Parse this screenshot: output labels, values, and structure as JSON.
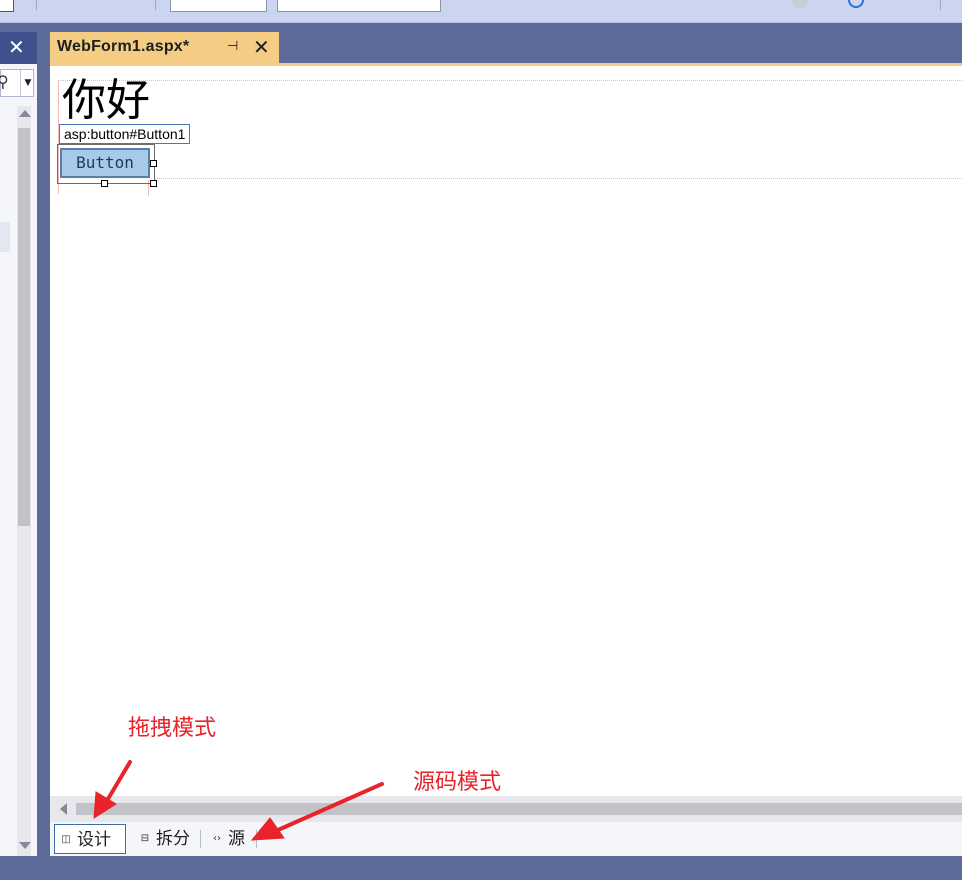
{
  "editor_tab": {
    "title": "WebForm1.aspx*",
    "pin_icon": "pin-icon",
    "close_icon": "close-icon"
  },
  "design_surface": {
    "heading_text": "你好",
    "selected_tag": "asp:button#Button1",
    "button_text": "Button"
  },
  "view_tabs": [
    {
      "label": "设计",
      "icon": "design-view-icon",
      "active": true
    },
    {
      "label": "拆分",
      "icon": "split-view-icon",
      "active": false
    },
    {
      "label": "源",
      "icon": "source-view-icon",
      "active": false
    }
  ],
  "annotations": {
    "drag_mode": "拖拽模式",
    "source_mode": "源码模式"
  },
  "colors": {
    "accent_tab": "#f5cc84",
    "chrome": "#5d6b99",
    "annotation_red": "#e8232a",
    "button_fill": "#a8c9e8"
  }
}
